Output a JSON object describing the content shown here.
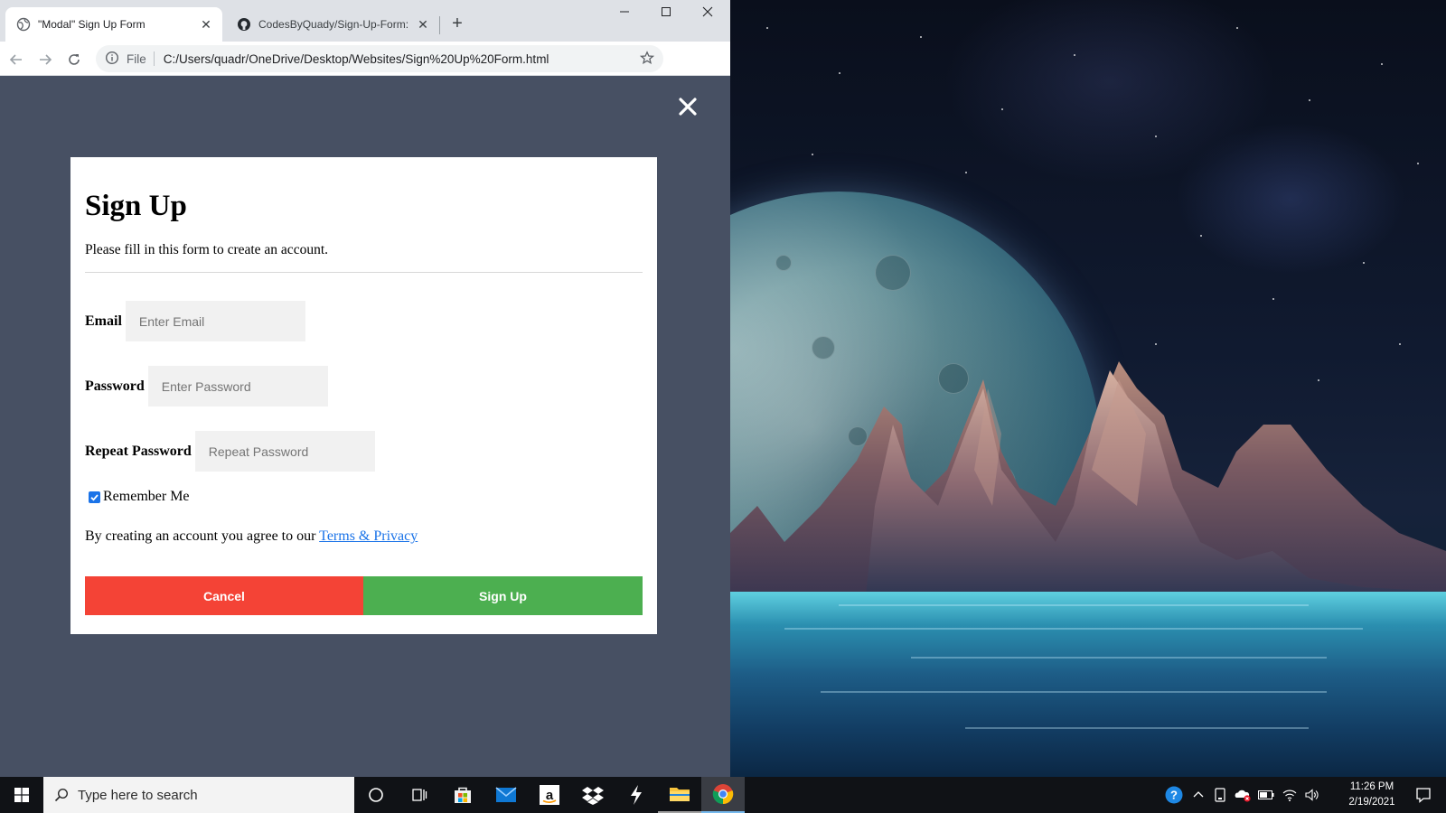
{
  "browser": {
    "tabs": [
      {
        "title": "\"Modal\" Sign Up Form",
        "close": "✕",
        "active": true,
        "icon": "globe-icon"
      },
      {
        "title": "CodesByQuady/Sign-Up-Form: A",
        "close": "✕",
        "active": false,
        "icon": "github-icon"
      }
    ],
    "new_tab": "+",
    "window_controls": {
      "minimize": "—",
      "maximize": "☐",
      "close": "✕"
    },
    "address_bar": {
      "scheme_label": "File",
      "url": "C:/Users/quadr/OneDrive/Desktop/Websites/Sign%20Up%20Form.html"
    },
    "menu_glyph": "⋮"
  },
  "modal": {
    "title": "Sign Up",
    "subtitle": "Please fill in this form to create an account.",
    "fields": [
      {
        "label": "Email",
        "placeholder": "Enter Email",
        "type": "text"
      },
      {
        "label": "Password",
        "placeholder": "Enter Password",
        "type": "password"
      },
      {
        "label": "Repeat Password",
        "placeholder": "Repeat Password",
        "type": "password"
      }
    ],
    "remember_label": "Remember Me",
    "remember_checked": true,
    "terms_prefix": "By creating an account you agree to our ",
    "terms_link": "Terms & Privacy",
    "cancel_label": "Cancel",
    "signup_label": "Sign Up",
    "colors": {
      "cancel": "#f44336",
      "signup": "#4caf50",
      "overlay": "#475063",
      "link": "#1a73e8"
    }
  },
  "taskbar": {
    "search_placeholder": "Type here to search",
    "time": "11:26 PM",
    "date": "2/19/2021",
    "pinned": [
      "cortana-icon",
      "task-view-icon",
      "store-icon",
      "mail-icon",
      "amazon-icon",
      "dropbox-icon",
      "app-icon",
      "file-explorer-icon",
      "chrome-icon"
    ]
  }
}
